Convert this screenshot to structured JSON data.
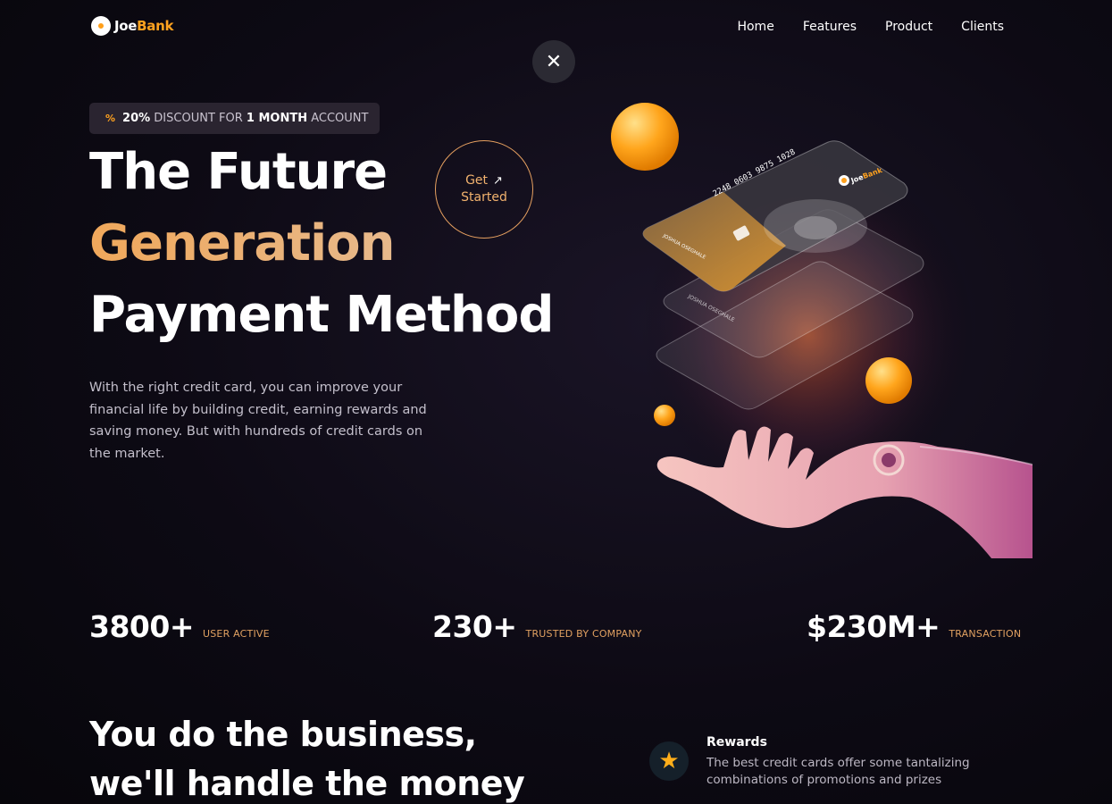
{
  "header": {
    "logo_prefix": "Joe",
    "logo_accent": "Bank",
    "nav": [
      "Home",
      "Features",
      "Product",
      "Clients"
    ]
  },
  "close_icon": "close-icon",
  "promo": {
    "icon": "percent-icon",
    "pct": "20%",
    "pre": "DISCOUNT FOR",
    "bold": "1 MONTH",
    "post": "ACCOUNT"
  },
  "hero": {
    "line1": "The Future",
    "line2": "Generation",
    "line3": "Payment Method",
    "description": "With the right credit card, you can improve your financial life by building credit, earning rewards and saving money. But with hundreds of credit cards on the market.",
    "cta_line1": "Get",
    "cta_line2": "Started"
  },
  "card": {
    "number": "2248 0603 9875 1028",
    "holder": "JOSHUA OSEGHALE",
    "brand_prefix": "Joe",
    "brand_accent": "Bank"
  },
  "stats": [
    {
      "num": "3800+",
      "label": "USER ACTIVE"
    },
    {
      "num": "230+",
      "label": "TRUSTED BY COMPANY"
    },
    {
      "num": "$230M+",
      "label": "TRANSACTION"
    }
  ],
  "business": {
    "line1": "You do the business,",
    "line2": "we'll handle the money"
  },
  "rewards": {
    "icon": "star-icon",
    "title": "Rewards",
    "description": "The best credit cards offer some tantalizing combinations of promotions and prizes"
  },
  "colors": {
    "accent": "#ffa21f",
    "background": "#0d0a14",
    "gold_text": "#f0a85b"
  }
}
